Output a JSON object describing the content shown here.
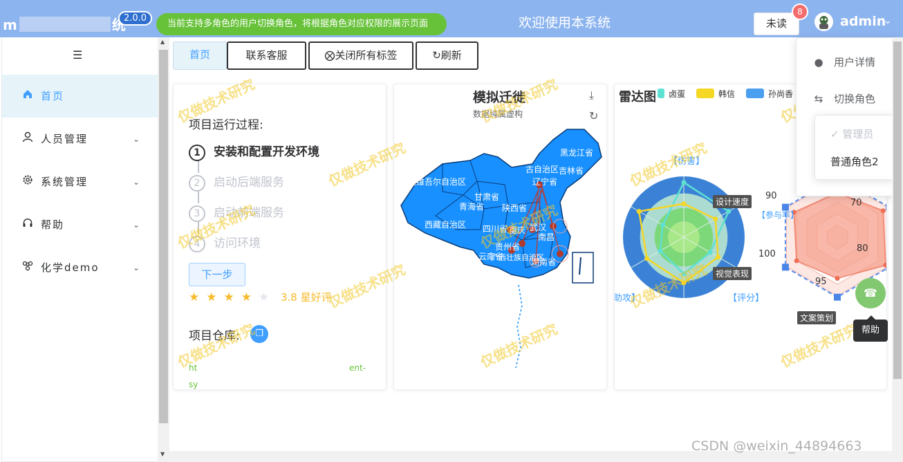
{
  "header": {
    "app_name_prefix": "m",
    "app_name_suffix": "统",
    "version": "2.0.0",
    "notice": "当前支持多角色的用户切换角色，将根据角色对应权限的展示页面",
    "welcome": "欢迎使用本系统",
    "unread_label": "未读",
    "unread_count": "8",
    "username": "admin"
  },
  "sidebar": {
    "items": [
      {
        "label": "首页",
        "icon": "home-icon",
        "active": true
      },
      {
        "label": "人员管理",
        "icon": "user-icon"
      },
      {
        "label": "系统管理",
        "icon": "gear-icon"
      },
      {
        "label": "帮助",
        "icon": "headset-icon"
      },
      {
        "label": "化学demo",
        "icon": "molecule-icon"
      }
    ]
  },
  "tabs": [
    {
      "label": "首页",
      "active": true
    },
    {
      "label": "联系客服"
    },
    {
      "label": "关闭所有标签",
      "icon": "close-circle-icon"
    },
    {
      "label": "刷新",
      "icon": "refresh-icon"
    }
  ],
  "steps_card": {
    "title": "项目运行过程:",
    "steps": [
      {
        "num": "1",
        "label": "安装和配置开发环境"
      },
      {
        "num": "2",
        "label": "启动后端服务"
      },
      {
        "num": "3",
        "label": "启动前端服务"
      },
      {
        "num": "4",
        "label": "访问环境"
      }
    ],
    "next_button": "下一步",
    "rating_value": 3.8,
    "rating_text": "3.8 星好评",
    "repo_label": "项目仓库:",
    "repo_url_start": "ht",
    "repo_url_end": "ent-",
    "repo_url_line2": "sy"
  },
  "map_card": {
    "title": "模拟迁徙",
    "subtitle": "数据纯属虚构",
    "regions": [
      "黑龙江省",
      "吉林省",
      "辽宁省",
      "古自治区",
      "新疆维吾尔自治区",
      "西藏自治区",
      "青海省",
      "甘肃省",
      "陕西省",
      "四川省",
      "贵州省",
      "云南省",
      "广西壮族自治区",
      "湖南省",
      "重庆",
      "武汉",
      "南昌"
    ]
  },
  "radar_card": {
    "title": "雷达图",
    "legend": [
      {
        "name": "卤蛋",
        "color": "#5ee0d2"
      },
      {
        "name": "韩信",
        "color": "#f5d726"
      },
      {
        "name": "孙尚香",
        "color": "#4a9ff0"
      }
    ],
    "indicators_left": [
      "【伤害】",
      "设计速度",
      "【参与率】",
      "视觉表现",
      "【评分】",
      "助攻】"
    ],
    "indicators_right": [
      "90",
      "70",
      "80",
      "100",
      "95",
      "文案策划"
    ],
    "series_left": [
      {
        "name": "卤蛋",
        "color": "#5ee0d2",
        "values": [
          0.9,
          0.85,
          0.5,
          0.6,
          0.45,
          0.4
        ]
      },
      {
        "name": "韩信",
        "color": "#f5d726",
        "values": [
          0.55,
          0.6,
          0.65,
          0.75,
          0.7,
          0.85
        ]
      }
    ],
    "series_right_values": [
      0.75,
      0.9,
      0.95,
      0.7,
      0.8,
      0.85
    ]
  },
  "user_dropdown": {
    "items": [
      {
        "label": "用户详情",
        "icon": "user-icon"
      },
      {
        "label": "切换角色",
        "icon": "switch-icon"
      }
    ],
    "roles": [
      {
        "label": "管理员",
        "checked": true
      },
      {
        "label": "普通角色2",
        "checked": false
      }
    ]
  },
  "help": {
    "tooltip": "帮助"
  },
  "watermark": "仅做技术研究",
  "footer_credit": "CSDN @weixin_44894663"
}
